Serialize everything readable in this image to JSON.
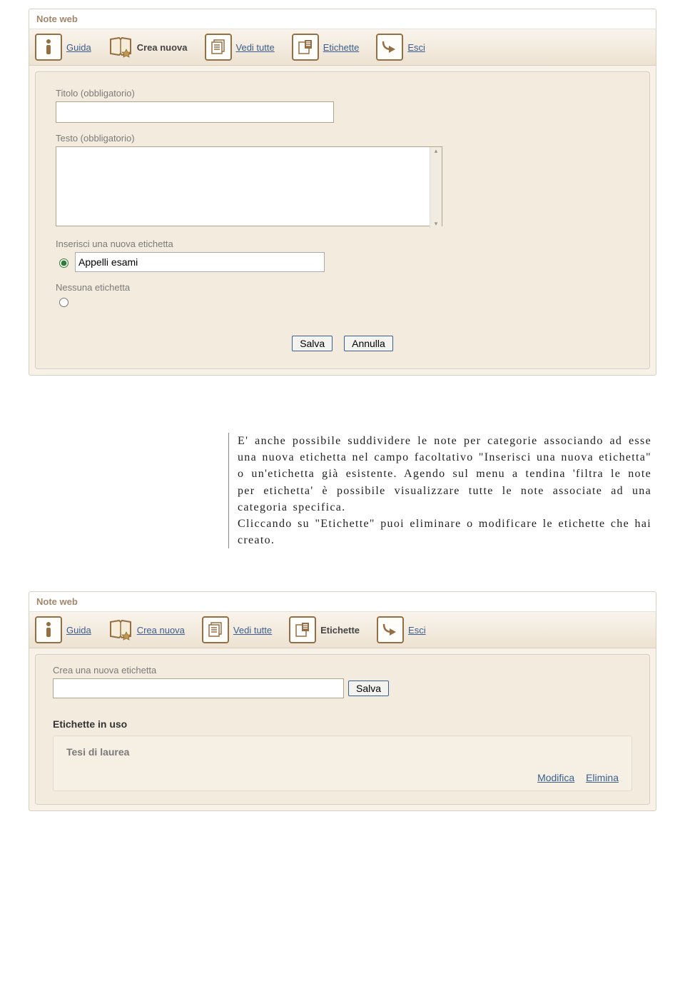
{
  "panel1": {
    "title": "Note web",
    "toolbar": [
      {
        "id": "guida",
        "label": "Guida",
        "icon": "info",
        "active": false
      },
      {
        "id": "crea-nuova",
        "label": "Crea nuova",
        "icon": "book-star",
        "active": true
      },
      {
        "id": "vedi-tutte",
        "label": "Vedi tutte",
        "icon": "pages",
        "active": false
      },
      {
        "id": "etichette",
        "label": "Etichette",
        "icon": "tag-box",
        "active": false
      },
      {
        "id": "esci",
        "label": "Esci",
        "icon": "arrow-out",
        "active": false
      }
    ],
    "form": {
      "title_label": "Titolo (obbligatorio)",
      "title_value": "",
      "text_label": "Testo (obbligatorio)",
      "text_value": "",
      "new_label": "Inserisci una nuova etichetta",
      "new_value": "Appelli esami",
      "none_label": "Nessuna etichetta",
      "save": "Salva",
      "cancel": "Annulla"
    }
  },
  "essay": {
    "p1": "E' anche possibile suddividere le note per categorie associando ad esse una nuova etichetta nel campo facoltativo \"Inserisci una nuova etichetta\" o un'etichetta già esistente. Agendo sul menu a tendina 'filtra le note per etichetta' è possibile visualizzare tutte le note associate ad una categoria specifica.",
    "p2": "Cliccando su \"Etichette\" puoi eliminare o modificare le etichette che hai creato."
  },
  "panel2": {
    "title": "Note web",
    "toolbar": [
      {
        "id": "guida",
        "label": "Guida",
        "icon": "info",
        "active": false
      },
      {
        "id": "crea-nuova",
        "label": "Crea nuova",
        "icon": "book-star",
        "active": false
      },
      {
        "id": "vedi-tutte",
        "label": "Vedi tutte",
        "icon": "pages",
        "active": false
      },
      {
        "id": "etichette",
        "label": "Etichette",
        "icon": "tag-box",
        "active": true
      },
      {
        "id": "esci",
        "label": "Esci",
        "icon": "arrow-out",
        "active": false
      }
    ],
    "create_label": "Crea una nuova etichetta",
    "create_value": "",
    "save": "Salva",
    "list_heading": "Etichette in uso",
    "labels": [
      {
        "name": "Tesi di laurea",
        "edit": "Modifica",
        "del": "Elimina"
      }
    ]
  }
}
